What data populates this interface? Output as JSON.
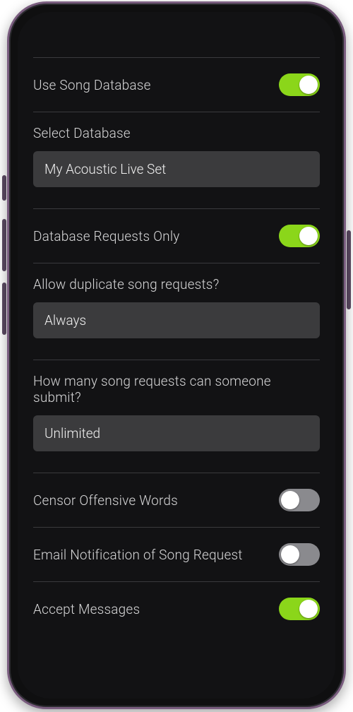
{
  "toggles": {
    "use_db": {
      "label": "Use Song Database",
      "on": true
    },
    "db_only": {
      "label": "Database Requests Only",
      "on": true
    },
    "censor": {
      "label": "Censor Offensive Words",
      "on": false
    },
    "email": {
      "label": "Email Notification of Song Request",
      "on": false
    },
    "accept": {
      "label": "Accept Messages",
      "on": true
    }
  },
  "select_database": {
    "label": "Select Database",
    "value": "My Acoustic Live Set"
  },
  "allow_duplicates": {
    "label": "Allow duplicate song requests?",
    "value": "Always"
  },
  "request_limit": {
    "label": "How many song requests can someone submit?",
    "value": "Unlimited"
  },
  "colors": {
    "accent": "#8bd61a"
  }
}
